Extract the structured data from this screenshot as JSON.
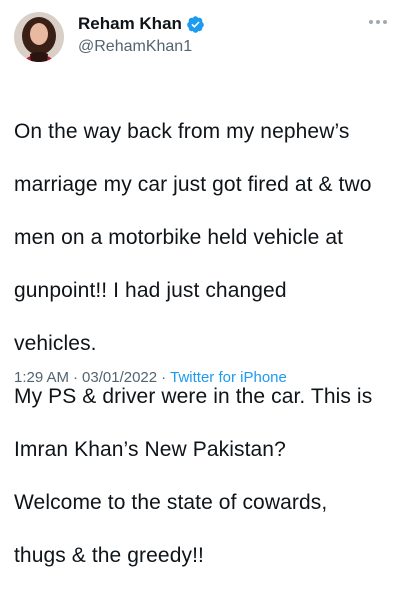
{
  "tweet": {
    "display_name": "Reham Khan",
    "handle": "@RehamKhan1",
    "verified_icon": "verified-badge-icon",
    "accent_color": "#1d9bf0",
    "body_lines": [
      "On the way back from my nephew’s",
      "marriage my car just got fired at & two",
      "men on a motorbike held vehicle at",
      "gunpoint!! I had just changed",
      "vehicles.",
      "My PS & driver were in the car. This is",
      "Imran Khan’s New Pakistan?",
      "Welcome to the state of cowards,",
      "thugs & the greedy!!"
    ],
    "time": "1:29 AM",
    "separator": "·",
    "date": "03/01/2022",
    "source": "Twitter for iPhone"
  }
}
